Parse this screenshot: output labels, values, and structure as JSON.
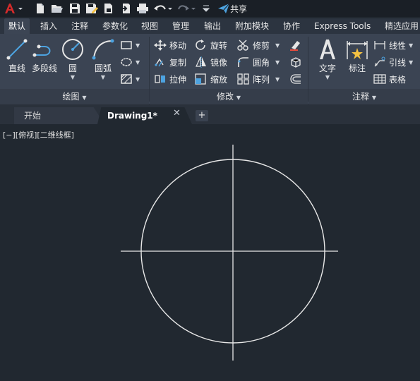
{
  "quick_access": {
    "app_icon": "autocad-a-icon",
    "share_label": "共享"
  },
  "ribbon_tabs": [
    {
      "label": "默认",
      "active": true
    },
    {
      "label": "插入"
    },
    {
      "label": "注释"
    },
    {
      "label": "参数化"
    },
    {
      "label": "视图"
    },
    {
      "label": "管理"
    },
    {
      "label": "输出"
    },
    {
      "label": "附加模块"
    },
    {
      "label": "协作"
    },
    {
      "label": "Express Tools"
    },
    {
      "label": "精选应用"
    }
  ],
  "draw_panel": {
    "title": "绘图",
    "line": "直线",
    "polyline": "多段线",
    "circle": "圆",
    "arc": "圆弧"
  },
  "modify_panel": {
    "title": "修改",
    "move": "移动",
    "rotate": "旋转",
    "trim": "修剪",
    "copy": "复制",
    "mirror": "镜像",
    "fillet": "圆角",
    "stretch": "拉伸",
    "scale": "缩放",
    "array": "阵列"
  },
  "annotation_panel": {
    "title": "注释",
    "text": "文字",
    "dimension": "标注",
    "linear": "线性",
    "leader": "引线",
    "table": "表格"
  },
  "doc_tabs": {
    "start": "开始",
    "drawing": "Drawing1*"
  },
  "viewport": {
    "label": "[−][俯视][二维线框]",
    "background": "#212830",
    "stroke": "#e8e8e8"
  },
  "colors": {
    "accent_red": "#d42b2b",
    "ribbon": "#3b4453",
    "tab_bar": "#2c3440"
  }
}
